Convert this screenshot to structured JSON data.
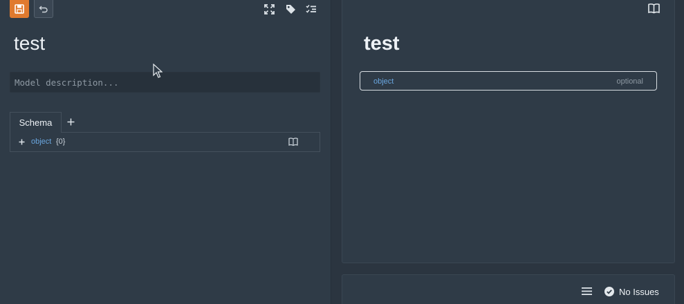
{
  "editor": {
    "model_title": "test",
    "description_placeholder": "Model description...",
    "tabs": [
      {
        "label": "Schema"
      }
    ],
    "schema": {
      "type": "object",
      "count": "{0}"
    }
  },
  "preview": {
    "title": "test",
    "property_type": "object",
    "property_requirement": "optional"
  },
  "status": {
    "issues_label": "No Issues"
  },
  "colors": {
    "accent": "#e07a2e",
    "link": "#6aa7e0",
    "background": "#2f3b47"
  },
  "icons": [
    "save-icon",
    "undo-icon",
    "expand-icon",
    "tag-icon",
    "checklist-icon",
    "plus-icon",
    "book-icon",
    "menu-icon",
    "check-circle-icon"
  ]
}
